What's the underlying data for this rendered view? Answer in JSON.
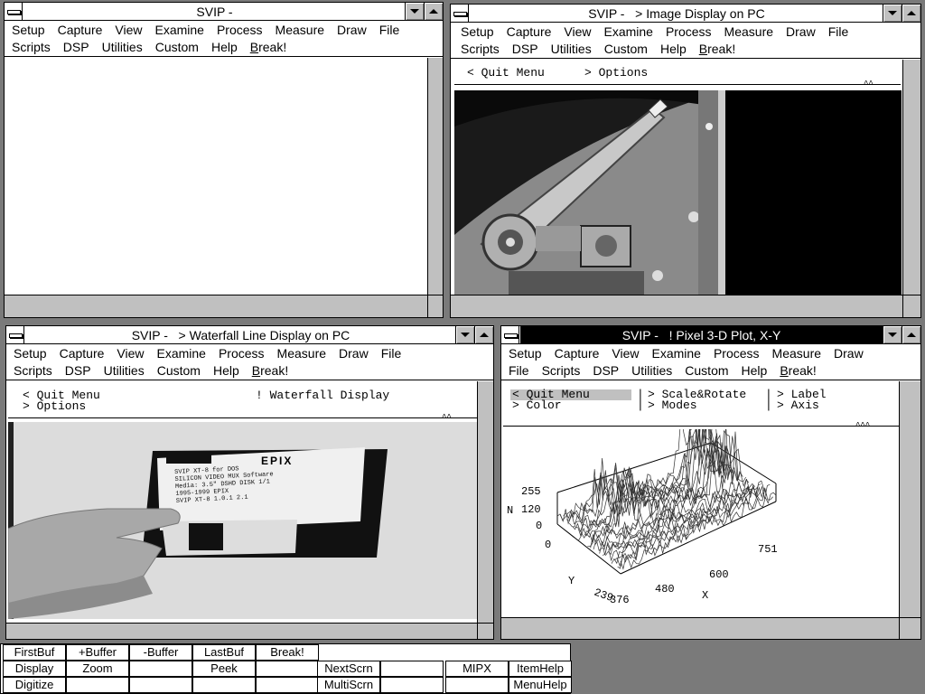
{
  "windows": {
    "w1": {
      "title": "SVIP -",
      "menu_row1": [
        "Setup",
        "Capture",
        "View",
        "Examine",
        "Process",
        "Measure",
        "Draw",
        "File"
      ],
      "menu_row2": [
        "Scripts",
        "DSP",
        "Utilities",
        "Custom",
        "Help",
        "Break!"
      ]
    },
    "w2": {
      "title": "SVIP -   > Image Display on PC",
      "menu_row1": [
        "Setup",
        "Capture",
        "View",
        "Examine",
        "Process",
        "Measure",
        "Draw",
        "File"
      ],
      "menu_row2": [
        "Scripts",
        "DSP",
        "Utilities",
        "Custom",
        "Help",
        "Break!"
      ],
      "img_menu": {
        "quit": "< Quit Menu",
        "options": "> Options"
      },
      "marks": "^^"
    },
    "w3": {
      "title": "SVIP -   > Waterfall Line Display on PC",
      "menu_row1": [
        "Setup",
        "Capture",
        "View",
        "Examine",
        "Process",
        "Measure",
        "Draw",
        "File"
      ],
      "menu_row2": [
        "Scripts",
        "DSP",
        "Utilities",
        "Custom",
        "Help",
        "Break!"
      ],
      "img_menu": {
        "quit": "< Quit Menu",
        "options": "> Options",
        "waterfall": "! Waterfall Display"
      },
      "marks": "^^",
      "disk_label": "EPIX",
      "disk_text": [
        "SVIP XT-8 for DOS",
        "SILICON VIDEO MUX Software",
        "Media: 3.5\" DSHD  DISK 1/1",
        "    1995-1999 EPIX",
        "SVIP XT-8 1.0.1 2.1"
      ]
    },
    "w4": {
      "title": "SVIP -   ! Pixel 3-D Plot, X-Y",
      "menu_row1": [
        "Setup",
        "Capture",
        "View",
        "Examine",
        "Process",
        "Measure",
        "Draw"
      ],
      "menu_row2": [
        "File",
        "Scripts",
        "DSP",
        "Utilities",
        "Custom",
        "Help",
        "Break!"
      ],
      "img_menu": {
        "quit": "< Quit Menu",
        "color": "> Color",
        "scale": "> Scale&Rotate",
        "modes": "> Modes",
        "label": "> Label",
        "axis": "> Axis"
      },
      "marks": "^^^",
      "plot": {
        "z_axis_label": "N",
        "z_ticks": [
          "255",
          "120",
          "0"
        ],
        "y_axis_label": "Y",
        "y_ticks": [
          "0",
          "239"
        ],
        "x_axis_label": "X",
        "x_ticks": [
          "376",
          "480",
          "600",
          "751"
        ]
      }
    }
  },
  "buttonbar": {
    "row1": [
      "FirstBuf",
      "+Buffer",
      "-Buffer",
      "LastBuf",
      "Break!"
    ],
    "row2": [
      "Display",
      "Zoom",
      "",
      "Peek",
      "",
      "NextScrn",
      "",
      "MIPX",
      "ItemHelp"
    ],
    "row3": [
      "Digitize",
      "",
      "",
      "",
      "",
      "MultiScrn",
      "",
      "",
      "MenuHelp"
    ]
  }
}
